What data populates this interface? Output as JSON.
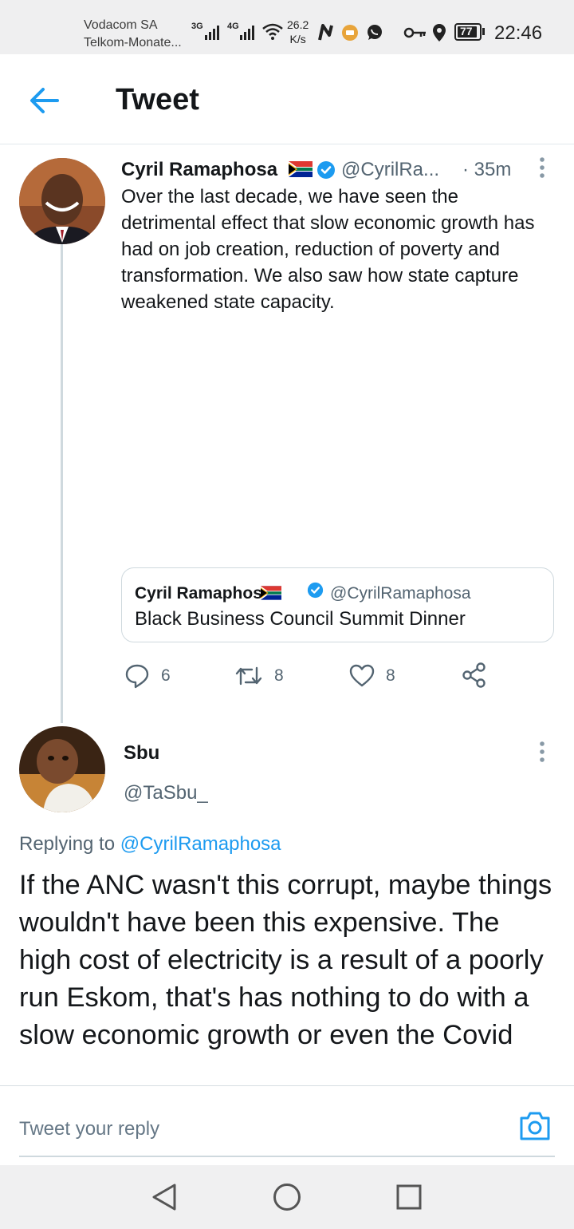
{
  "status_bar": {
    "carrier_1": "Vodacom SA",
    "carrier_2": "Telkom-Monate...",
    "net_1": "3G",
    "net_2": "4G",
    "speed_value": "26.2",
    "speed_unit": "K/s",
    "battery": "77",
    "time": "22:46"
  },
  "header": {
    "title": "Tweet"
  },
  "tweet": {
    "author_name": "Cyril Ramaphosa",
    "author_handle": "@CyrilRa...",
    "time": "· 35m",
    "text": "Over the last decade, we have seen the detrimental effect that slow economic growth has had on job creation, reduction of poverty and transformation. We also saw how state capture weakened state capacity.",
    "quote": {
      "author_name": "Cyril Ramaphosa",
      "author_handle": "@CyrilRamaphosa",
      "text": "Black Business Council Summit Dinner"
    },
    "replies_count": "6",
    "retweets_count": "8",
    "likes_count": "8"
  },
  "reply": {
    "author_name": "Sbu",
    "author_handle": "@TaSbu_",
    "replying_prefix": "Replying to",
    "replying_handle": "@CyrilRamaphosa",
    "text": "If the ANC wasn't this corrupt, maybe things wouldn't have been this expensive. The high cost of electricity is a result of a poorly run Eskom, that's has nothing to do with a slow economic growth or even the Covid"
  },
  "composer": {
    "placeholder": "Tweet your reply"
  },
  "colors": {
    "accent": "#1d9bf0",
    "verified": "#1d9bf0",
    "secondary_text": "#536471"
  }
}
